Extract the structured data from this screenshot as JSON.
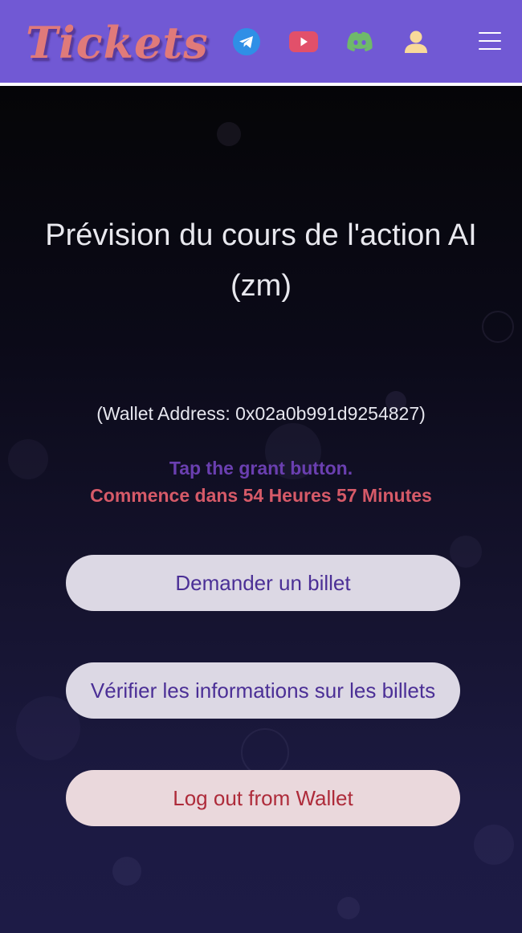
{
  "header": {
    "logo_text": "Tickets",
    "bg_color": "#7159d4",
    "icons": [
      "telegram-icon",
      "youtube-icon",
      "discord-icon",
      "user-icon",
      "menu-icon"
    ]
  },
  "main": {
    "title": "Prévision du cours de l'action AI (zm)",
    "wallet_text": "(Wallet Address: 0x02a0b991d9254827)",
    "tap_text": "Tap the grant button.",
    "countdown_text": "Commence dans 54 Heures 57 Minutes",
    "buttons": {
      "request_label": "Demander un billet",
      "verify_label": "Vérifier les informations sur les billets",
      "logout_label": "Log out from Wallet"
    }
  },
  "colors": {
    "accent_purple": "#4b2f96",
    "countdown_red": "#d65a68",
    "logout_red": "#ae2b3a",
    "tap_purple": "#6a3fb0"
  }
}
